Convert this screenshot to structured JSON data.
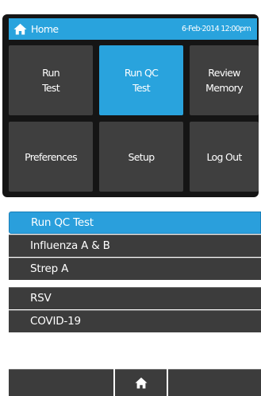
{
  "header": {
    "title": "Home",
    "datetime": "6-Feb-2014 12:00pm",
    "home_icon": "home-icon"
  },
  "tiles": [
    {
      "label": "Run\nTest"
    },
    {
      "label": "Run QC\nTest"
    },
    {
      "label": "Review\nMemory"
    },
    {
      "label": "Preferences"
    },
    {
      "label": "Setup"
    },
    {
      "label": "Log Out"
    }
  ],
  "list": {
    "items": [
      {
        "label": "Run QC Test"
      },
      {
        "label": "Influenza A & B"
      },
      {
        "label": "Strep A"
      },
      {
        "label": "RSV"
      },
      {
        "label": "COVID-19"
      }
    ]
  },
  "bottom_bar": {
    "home_icon": "home-icon"
  },
  "colors": {
    "accent": "#29a3dd",
    "tile": "#3f3f3f",
    "panel": "#151515",
    "list_item": "#3c3c3c"
  }
}
